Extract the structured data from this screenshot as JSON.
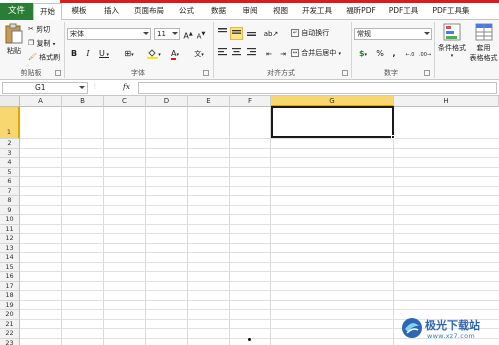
{
  "tabs": {
    "file": "文件",
    "items": [
      "开始",
      "模板",
      "插入",
      "页面布局",
      "公式",
      "数据",
      "审阅",
      "视图",
      "开发工具",
      "福昕PDF",
      "PDF工具",
      "PDF工具集"
    ],
    "active_index": 0
  },
  "ribbon": {
    "clipboard": {
      "paste": "粘贴",
      "cut": "剪切",
      "copy": "复制",
      "format_painter": "格式刷",
      "group_label": "剪贴板"
    },
    "font": {
      "font_name": "宋体",
      "font_size": "11",
      "grow": "A",
      "shrink": "A",
      "bold": "B",
      "italic": "I",
      "underline": "U",
      "text_color_glyph": "A",
      "phonetic_glyph": "文",
      "group_label": "字体"
    },
    "alignment": {
      "wrap_text": "自动换行",
      "merge_center": "合并后居中",
      "group_label": "对齐方式"
    },
    "number": {
      "format": "常规",
      "currency": "$",
      "percent": "%",
      "comma": ",",
      "group_label": "数字"
    },
    "styles": {
      "conditional": "条件格式",
      "table_format_1": "套用",
      "table_format_2": "表格格式"
    }
  },
  "formula_bar": {
    "name_box": "G1",
    "fx": "fx",
    "content": ""
  },
  "grid": {
    "columns": [
      "A",
      "B",
      "C",
      "D",
      "E",
      "F",
      "G",
      "H"
    ],
    "rows": [
      "1",
      "2",
      "3",
      "4",
      "5",
      "6",
      "7",
      "8",
      "9",
      "10",
      "11",
      "12",
      "13",
      "14",
      "15",
      "16",
      "17",
      "18",
      "19",
      "20",
      "21",
      "22",
      "23"
    ],
    "selected_column": "G",
    "selected_row": "1",
    "selected_cell_value": ""
  },
  "watermark": {
    "title": "极光下载站",
    "url": "www.xz7.com"
  },
  "colors": {
    "file_tab": "#2a7d34",
    "accent_red": "#e31818",
    "selection_header": "#f8d771"
  }
}
